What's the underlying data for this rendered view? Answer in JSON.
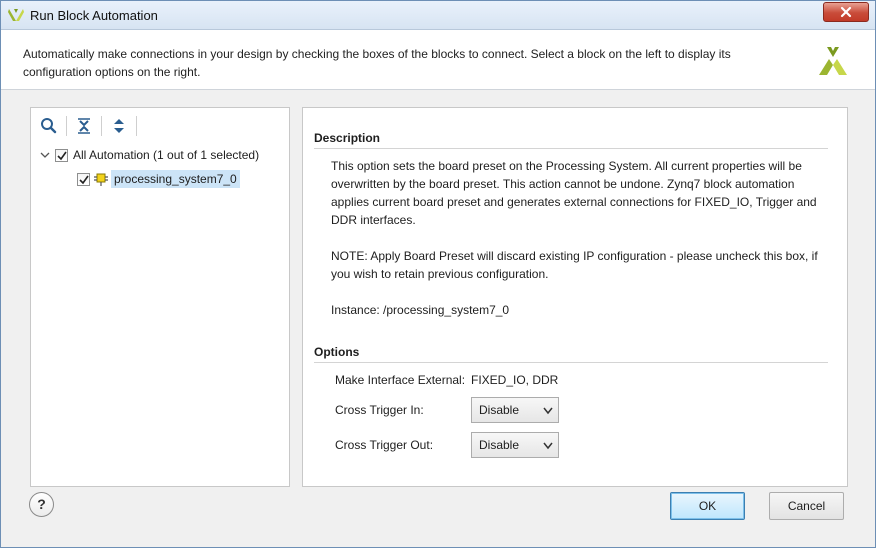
{
  "window": {
    "title": "Run Block Automation"
  },
  "header": {
    "description": "Automatically make connections in your design by checking the boxes of the blocks to connect. Select a block on the left to display its configuration options on the right."
  },
  "tree": {
    "root_label": "All Automation (1 out of 1 selected)",
    "root_checked": true,
    "child_label": "processing_system7_0",
    "child_checked": true
  },
  "details": {
    "description_heading": "Description",
    "description_text": "This option sets the board preset on the Processing System. All current properties will be overwritten by the board preset. This action cannot be undone. Zynq7 block automation applies current board preset and generates external connections for FIXED_IO, Trigger and DDR interfaces.",
    "note_text": "NOTE: Apply Board Preset will discard existing IP configuration - please uncheck this box, if you wish to retain previous configuration.",
    "instance_text": "Instance: /processing_system7_0",
    "options_heading": "Options",
    "make_interface_label": "Make Interface External:",
    "make_interface_value": "FIXED_IO, DDR",
    "cross_trigger_in_label": "Cross Trigger In:",
    "cross_trigger_in_value": "Disable",
    "cross_trigger_out_label": "Cross Trigger Out:",
    "cross_trigger_out_value": "Disable"
  },
  "footer": {
    "help_label": "?",
    "ok_label": "OK",
    "cancel_label": "Cancel"
  },
  "icons": {
    "title": "vivado-logo-icon",
    "close": "close-icon",
    "search": "search-icon",
    "collapse": "collapse-all-icon",
    "expand": "expand-all-icon",
    "ip_block": "ip-block-icon",
    "header_logo": "xilinx-logo-icon"
  },
  "colors": {
    "accent": "#7dc0ea",
    "selection": "#cce4f7",
    "logo": "#9bb530"
  }
}
